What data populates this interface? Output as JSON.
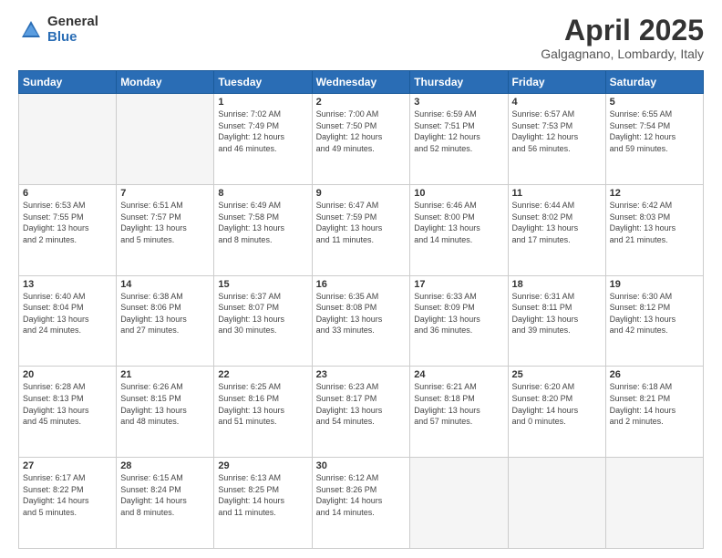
{
  "header": {
    "logo": {
      "general": "General",
      "blue": "Blue"
    },
    "title": "April 2025",
    "subtitle": "Galgagnano, Lombardy, Italy"
  },
  "days_of_week": [
    "Sunday",
    "Monday",
    "Tuesday",
    "Wednesday",
    "Thursday",
    "Friday",
    "Saturday"
  ],
  "weeks": [
    [
      {
        "day": "",
        "info": ""
      },
      {
        "day": "",
        "info": ""
      },
      {
        "day": "1",
        "info": "Sunrise: 7:02 AM\nSunset: 7:49 PM\nDaylight: 12 hours\nand 46 minutes."
      },
      {
        "day": "2",
        "info": "Sunrise: 7:00 AM\nSunset: 7:50 PM\nDaylight: 12 hours\nand 49 minutes."
      },
      {
        "day": "3",
        "info": "Sunrise: 6:59 AM\nSunset: 7:51 PM\nDaylight: 12 hours\nand 52 minutes."
      },
      {
        "day": "4",
        "info": "Sunrise: 6:57 AM\nSunset: 7:53 PM\nDaylight: 12 hours\nand 56 minutes."
      },
      {
        "day": "5",
        "info": "Sunrise: 6:55 AM\nSunset: 7:54 PM\nDaylight: 12 hours\nand 59 minutes."
      }
    ],
    [
      {
        "day": "6",
        "info": "Sunrise: 6:53 AM\nSunset: 7:55 PM\nDaylight: 13 hours\nand 2 minutes."
      },
      {
        "day": "7",
        "info": "Sunrise: 6:51 AM\nSunset: 7:57 PM\nDaylight: 13 hours\nand 5 minutes."
      },
      {
        "day": "8",
        "info": "Sunrise: 6:49 AM\nSunset: 7:58 PM\nDaylight: 13 hours\nand 8 minutes."
      },
      {
        "day": "9",
        "info": "Sunrise: 6:47 AM\nSunset: 7:59 PM\nDaylight: 13 hours\nand 11 minutes."
      },
      {
        "day": "10",
        "info": "Sunrise: 6:46 AM\nSunset: 8:00 PM\nDaylight: 13 hours\nand 14 minutes."
      },
      {
        "day": "11",
        "info": "Sunrise: 6:44 AM\nSunset: 8:02 PM\nDaylight: 13 hours\nand 17 minutes."
      },
      {
        "day": "12",
        "info": "Sunrise: 6:42 AM\nSunset: 8:03 PM\nDaylight: 13 hours\nand 21 minutes."
      }
    ],
    [
      {
        "day": "13",
        "info": "Sunrise: 6:40 AM\nSunset: 8:04 PM\nDaylight: 13 hours\nand 24 minutes."
      },
      {
        "day": "14",
        "info": "Sunrise: 6:38 AM\nSunset: 8:06 PM\nDaylight: 13 hours\nand 27 minutes."
      },
      {
        "day": "15",
        "info": "Sunrise: 6:37 AM\nSunset: 8:07 PM\nDaylight: 13 hours\nand 30 minutes."
      },
      {
        "day": "16",
        "info": "Sunrise: 6:35 AM\nSunset: 8:08 PM\nDaylight: 13 hours\nand 33 minutes."
      },
      {
        "day": "17",
        "info": "Sunrise: 6:33 AM\nSunset: 8:09 PM\nDaylight: 13 hours\nand 36 minutes."
      },
      {
        "day": "18",
        "info": "Sunrise: 6:31 AM\nSunset: 8:11 PM\nDaylight: 13 hours\nand 39 minutes."
      },
      {
        "day": "19",
        "info": "Sunrise: 6:30 AM\nSunset: 8:12 PM\nDaylight: 13 hours\nand 42 minutes."
      }
    ],
    [
      {
        "day": "20",
        "info": "Sunrise: 6:28 AM\nSunset: 8:13 PM\nDaylight: 13 hours\nand 45 minutes."
      },
      {
        "day": "21",
        "info": "Sunrise: 6:26 AM\nSunset: 8:15 PM\nDaylight: 13 hours\nand 48 minutes."
      },
      {
        "day": "22",
        "info": "Sunrise: 6:25 AM\nSunset: 8:16 PM\nDaylight: 13 hours\nand 51 minutes."
      },
      {
        "day": "23",
        "info": "Sunrise: 6:23 AM\nSunset: 8:17 PM\nDaylight: 13 hours\nand 54 minutes."
      },
      {
        "day": "24",
        "info": "Sunrise: 6:21 AM\nSunset: 8:18 PM\nDaylight: 13 hours\nand 57 minutes."
      },
      {
        "day": "25",
        "info": "Sunrise: 6:20 AM\nSunset: 8:20 PM\nDaylight: 14 hours\nand 0 minutes."
      },
      {
        "day": "26",
        "info": "Sunrise: 6:18 AM\nSunset: 8:21 PM\nDaylight: 14 hours\nand 2 minutes."
      }
    ],
    [
      {
        "day": "27",
        "info": "Sunrise: 6:17 AM\nSunset: 8:22 PM\nDaylight: 14 hours\nand 5 minutes."
      },
      {
        "day": "28",
        "info": "Sunrise: 6:15 AM\nSunset: 8:24 PM\nDaylight: 14 hours\nand 8 minutes."
      },
      {
        "day": "29",
        "info": "Sunrise: 6:13 AM\nSunset: 8:25 PM\nDaylight: 14 hours\nand 11 minutes."
      },
      {
        "day": "30",
        "info": "Sunrise: 6:12 AM\nSunset: 8:26 PM\nDaylight: 14 hours\nand 14 minutes."
      },
      {
        "day": "",
        "info": ""
      },
      {
        "day": "",
        "info": ""
      },
      {
        "day": "",
        "info": ""
      }
    ]
  ]
}
